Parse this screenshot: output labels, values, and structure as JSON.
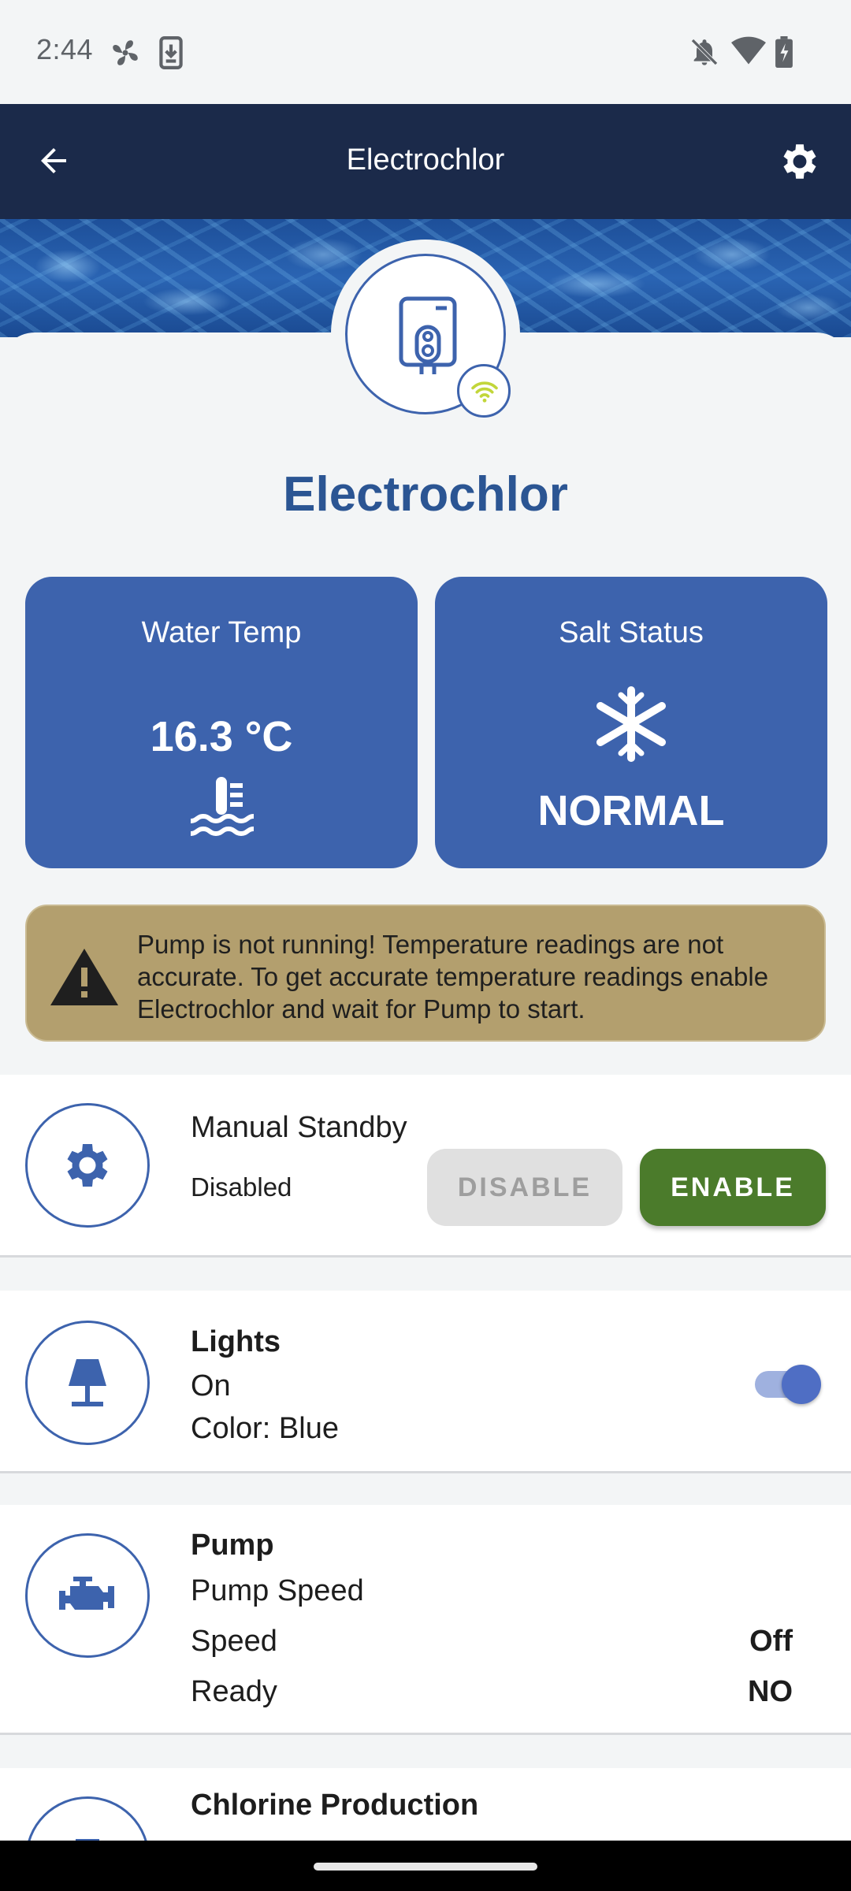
{
  "status_bar": {
    "time": "2:44"
  },
  "app_bar": {
    "title": "Electrochlor"
  },
  "device": {
    "name": "Electrochlor"
  },
  "tiles": {
    "water_temp": {
      "label": "Water Temp",
      "value": "16.3 °C"
    },
    "salt_status": {
      "label": "Salt Status",
      "value": "NORMAL"
    }
  },
  "warning": {
    "text": "Pump is not running! Temperature readings are not accurate. To get accurate temperature readings enable Electrochlor and wait for Pump to start."
  },
  "standby": {
    "title": "Manual Standby",
    "state": "Disabled",
    "disable_label": "DISABLE",
    "enable_label": "ENABLE"
  },
  "lights": {
    "title": "Lights",
    "state": "On",
    "color": "Color: Blue",
    "toggle_on": true
  },
  "pump": {
    "title": "Pump",
    "subtitle": "Pump Speed",
    "rows": [
      {
        "label": "Speed",
        "value": "Off"
      },
      {
        "label": "Ready",
        "value": "NO"
      }
    ]
  },
  "chlorine": {
    "title": "Chlorine Production"
  },
  "colors": {
    "app_bar": "#1b2a4a",
    "tile": "#3d63ad",
    "title_blue": "#2b5593",
    "warning_bg": "#b39f6e",
    "enable_green": "#4b7b2b"
  }
}
